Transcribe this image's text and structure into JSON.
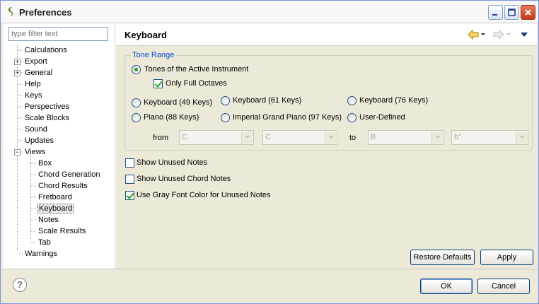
{
  "window": {
    "title": "Preferences"
  },
  "filter": {
    "placeholder": "type filter text"
  },
  "tree": {
    "items": [
      {
        "label": "Calculations",
        "level": 0
      },
      {
        "label": "Export",
        "level": 0,
        "expander": "+"
      },
      {
        "label": "General",
        "level": 0,
        "expander": "+"
      },
      {
        "label": "Help",
        "level": 0
      },
      {
        "label": "Keys",
        "level": 0
      },
      {
        "label": "Perspectives",
        "level": 0
      },
      {
        "label": "Scale Blocks",
        "level": 0
      },
      {
        "label": "Sound",
        "level": 0
      },
      {
        "label": "Updates",
        "level": 0
      },
      {
        "label": "Views",
        "level": 0,
        "expander": "−"
      },
      {
        "label": "Box",
        "level": 1
      },
      {
        "label": "Chord Generation",
        "level": 1
      },
      {
        "label": "Chord Results",
        "level": 1
      },
      {
        "label": "Fretboard",
        "level": 1
      },
      {
        "label": "Keyboard",
        "level": 1,
        "selected": true
      },
      {
        "label": "Notes",
        "level": 1
      },
      {
        "label": "Scale Results",
        "level": 1
      },
      {
        "label": "Tab",
        "level": 1
      },
      {
        "label": "Warnings",
        "level": 0
      }
    ]
  },
  "page": {
    "title": "Keyboard",
    "tone_range": {
      "title": "Tone Range",
      "active_instrument": "Tones of the Active Instrument",
      "only_full_octaves": "Only Full Octaves",
      "options": [
        "Keyboard (49 Keys)",
        "Keyboard (61 Keys)",
        "Keyboard (76 Keys)",
        "Piano (88 Keys)",
        "Imperial Grand Piano (97 Keys)",
        "User-Defined"
      ],
      "from_label": "from",
      "to_label": "to",
      "from_note": "C",
      "from_octave": "C",
      "to_note": "B",
      "to_octave": "b''"
    },
    "show_unused_notes": "Show Unused Notes",
    "show_unused_chord_notes": "Show Unused Chord Notes",
    "use_gray_font": "Use Gray Font Color for Unused Notes",
    "restore_defaults": "Restore Defaults",
    "apply": "Apply"
  },
  "footer": {
    "ok": "OK",
    "cancel": "Cancel",
    "help": "?"
  },
  "colors": {
    "accent": "#0046d5",
    "check": "#21a121"
  }
}
